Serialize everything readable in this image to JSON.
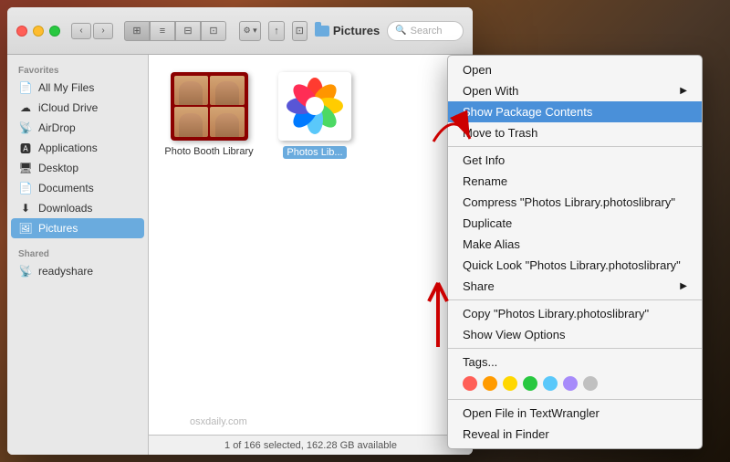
{
  "desktop": {
    "bg": "mountain landscape"
  },
  "finder": {
    "title": "Pictures",
    "nav": {
      "back_label": "‹",
      "forward_label": "›"
    },
    "view_buttons": [
      "icon",
      "list",
      "column",
      "gallery"
    ],
    "search_placeholder": "Search",
    "action_gear": "⚙",
    "share_icon": "↑",
    "springload_icon": "⊡"
  },
  "sidebar": {
    "favorites_label": "Favorites",
    "items": [
      {
        "id": "all-my-files",
        "label": "All My Files",
        "icon": "📄"
      },
      {
        "id": "icloud-drive",
        "label": "iCloud Drive",
        "icon": "☁"
      },
      {
        "id": "airdrop",
        "label": "AirDrop",
        "icon": "📡"
      },
      {
        "id": "applications",
        "label": "Applications",
        "icon": "🅰"
      },
      {
        "id": "desktop",
        "label": "Desktop",
        "icon": "🖥"
      },
      {
        "id": "documents",
        "label": "Documents",
        "icon": "📄"
      },
      {
        "id": "downloads",
        "label": "Downloads",
        "icon": "⬇"
      },
      {
        "id": "pictures",
        "label": "Pictures",
        "icon": "🖼",
        "active": true
      }
    ],
    "shared_label": "Shared",
    "shared_items": [
      {
        "id": "readyshare",
        "label": "readyshare",
        "icon": "📡"
      }
    ]
  },
  "main": {
    "files": [
      {
        "id": "photobooth",
        "label": "Photo Booth Library",
        "selected": false
      },
      {
        "id": "photos",
        "label": "Photos Lib...",
        "selected": true
      }
    ],
    "status": "1 of 166 selected, 162.28 GB available",
    "watermark": "osxdaily.com"
  },
  "context_menu": {
    "items": [
      {
        "id": "open",
        "label": "Open",
        "type": "item"
      },
      {
        "id": "open-with",
        "label": "Open With",
        "type": "item",
        "submenu": true
      },
      {
        "id": "show-package",
        "label": "Show Package Contents",
        "type": "item",
        "highlighted": true
      },
      {
        "id": "move-to-trash",
        "label": "Move to Trash",
        "type": "item"
      },
      {
        "id": "sep1",
        "type": "separator"
      },
      {
        "id": "get-info",
        "label": "Get Info",
        "type": "item"
      },
      {
        "id": "rename",
        "label": "Rename",
        "type": "item"
      },
      {
        "id": "compress",
        "label": "Compress \"Photos Library.photoslibrary\"",
        "type": "item"
      },
      {
        "id": "duplicate",
        "label": "Duplicate",
        "type": "item"
      },
      {
        "id": "make-alias",
        "label": "Make Alias",
        "type": "item"
      },
      {
        "id": "quick-look",
        "label": "Quick Look \"Photos Library.photoslibrary\"",
        "type": "item"
      },
      {
        "id": "share",
        "label": "Share",
        "type": "item",
        "submenu": true
      },
      {
        "id": "sep2",
        "type": "separator"
      },
      {
        "id": "copy",
        "label": "Copy \"Photos Library.photoslibrary\"",
        "type": "item"
      },
      {
        "id": "show-view",
        "label": "Show View Options",
        "type": "item"
      },
      {
        "id": "sep3",
        "type": "separator"
      },
      {
        "id": "tags",
        "label": "Tags...",
        "type": "item"
      },
      {
        "id": "tag-dots",
        "type": "tags"
      },
      {
        "id": "sep4",
        "type": "separator"
      },
      {
        "id": "open-textwrangler",
        "label": "Open File in TextWrangler",
        "type": "item"
      },
      {
        "id": "reveal",
        "label": "Reveal in Finder",
        "type": "item"
      }
    ],
    "tag_colors": [
      "#FF5F57",
      "#FF9B00",
      "#FFD700",
      "#28C840",
      "#5AC8FA",
      "#A78BFA",
      "#C0C0C0"
    ]
  }
}
